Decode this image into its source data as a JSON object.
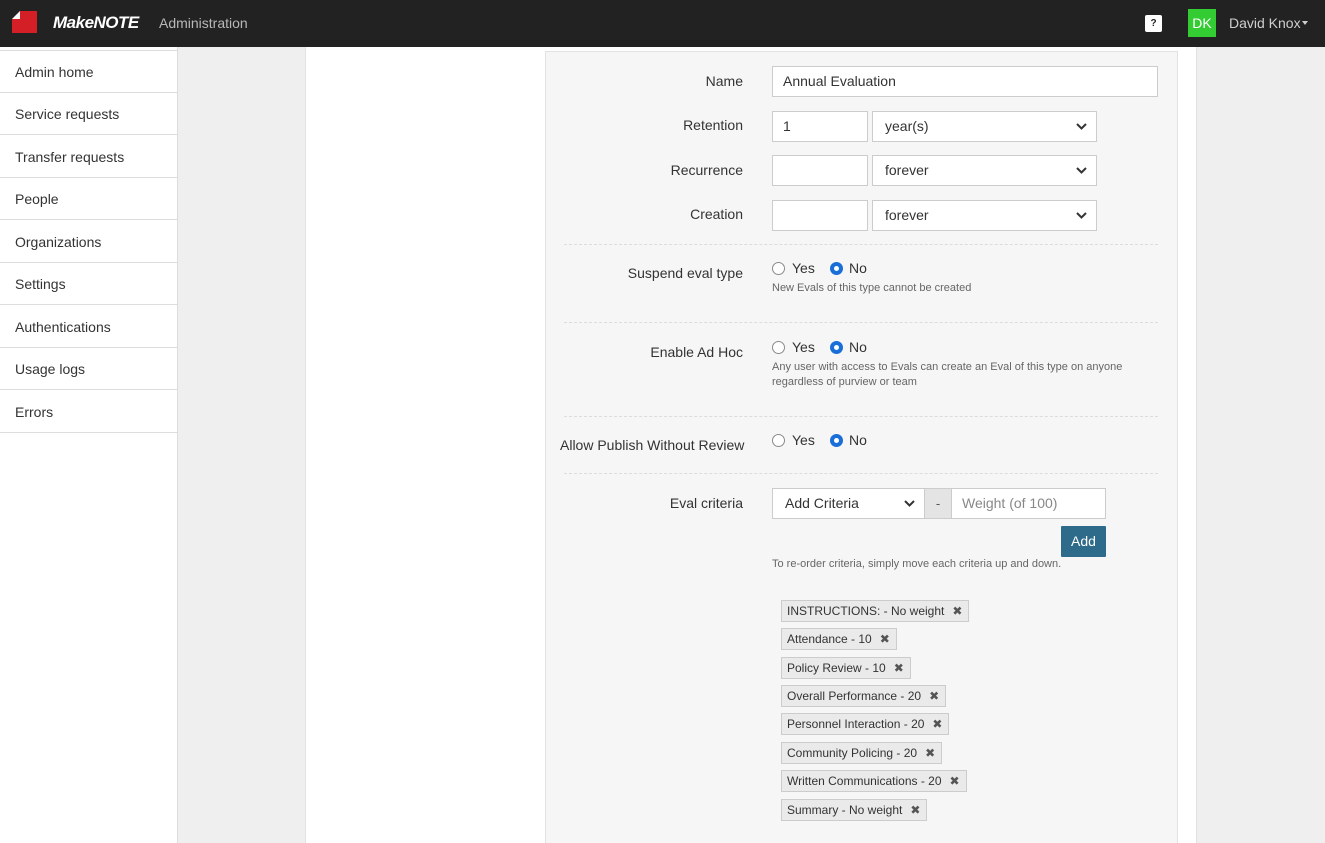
{
  "header": {
    "brand": "MakeNOTE",
    "section": "Administration",
    "help_label": "?",
    "user_initials": "DK",
    "user_name": "David Knox",
    "brand_color": "#d41f26",
    "avatar_color": "#33cc33"
  },
  "sidebar": {
    "items": [
      {
        "label": "Admin home"
      },
      {
        "label": "Service requests"
      },
      {
        "label": "Transfer requests"
      },
      {
        "label": "People"
      },
      {
        "label": "Organizations"
      },
      {
        "label": "Settings"
      },
      {
        "label": "Authentications"
      },
      {
        "label": "Usage logs"
      },
      {
        "label": "Errors"
      }
    ]
  },
  "form": {
    "name": {
      "label": "Name",
      "value": "Annual Evaluation"
    },
    "retention": {
      "label": "Retention",
      "value": "1",
      "unit": "year(s)"
    },
    "recurrence": {
      "label": "Recurrence",
      "value": "",
      "unit": "forever"
    },
    "creation": {
      "label": "Creation",
      "value": "",
      "unit": "forever"
    },
    "suspend": {
      "label": "Suspend eval type",
      "yes": "Yes",
      "no": "No",
      "selected": "No",
      "help": "New Evals of this type cannot be created"
    },
    "adhoc": {
      "label": "Enable Ad Hoc",
      "yes": "Yes",
      "no": "No",
      "selected": "No",
      "help_line1": "Any user with access to Evals can create an Eval of this type on anyone",
      "help_line2": "regardless of purview or team"
    },
    "publish": {
      "label": "Allow Publish Without Review",
      "yes": "Yes",
      "no": "No",
      "selected": "No"
    },
    "criteria": {
      "label": "Eval criteria",
      "select_value": "Add Criteria",
      "separator": "-",
      "weight_placeholder": "Weight (of 100)",
      "add_label": "Add",
      "help": "To re-order criteria, simply move each criteria up and down.",
      "items": [
        {
          "label": "INSTRUCTIONS: - No weight"
        },
        {
          "label": "Attendance - 10"
        },
        {
          "label": "Policy Review - 10"
        },
        {
          "label": "Overall Performance - 20"
        },
        {
          "label": "Personnel Interaction - 20"
        },
        {
          "label": "Community Policing - 20"
        },
        {
          "label": "Written Communications - 20"
        },
        {
          "label": "Summary - No weight"
        }
      ],
      "remove_symbol": "✖"
    }
  }
}
